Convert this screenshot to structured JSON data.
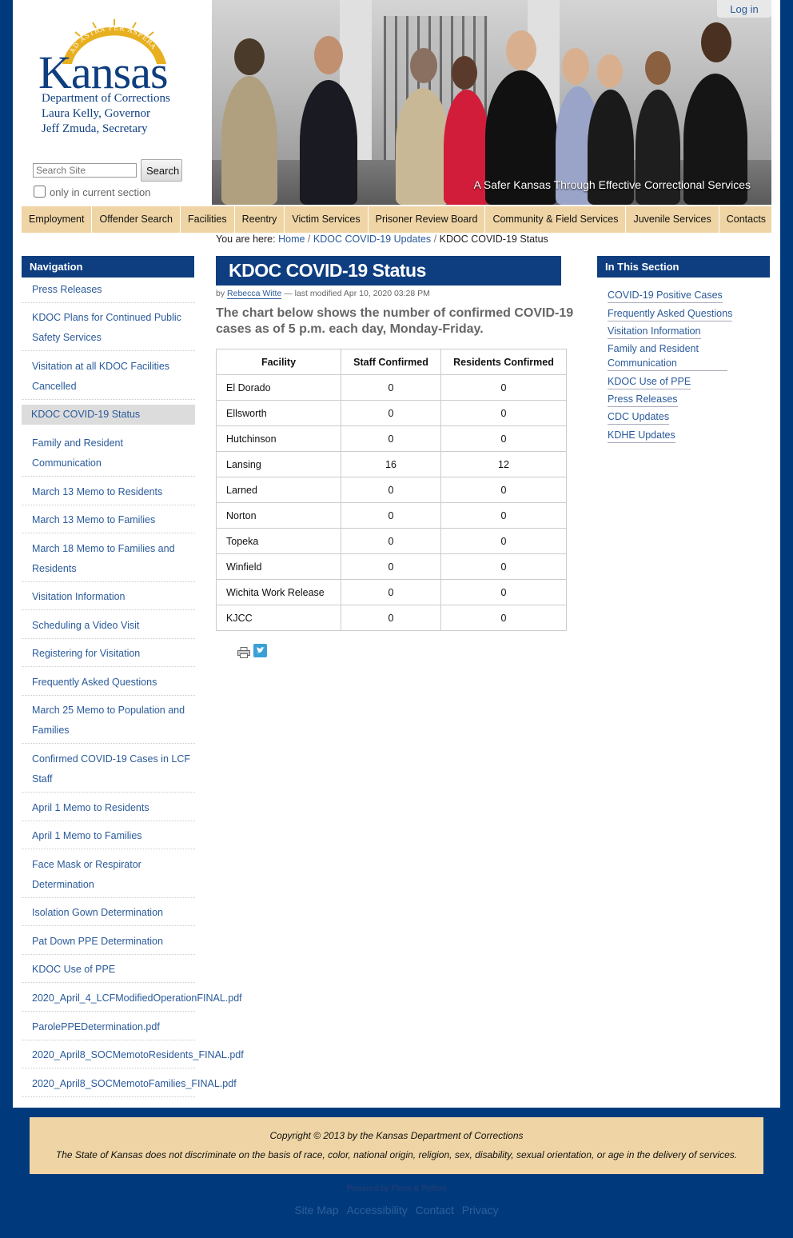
{
  "header": {
    "logo": {
      "motto": "AD ASTRA PER ASPERA",
      "word": "Kansas",
      "lines": [
        "Department of Corrections",
        "Laura Kelly, Governor",
        "Jeff Zmuda, Secretary"
      ]
    },
    "search": {
      "placeholder": "Search Site",
      "button_label": "Search",
      "checkbox_label": "only in current section"
    },
    "banner_tagline": "A Safer Kansas Through Effective Correctional Services",
    "login_label": "Log in"
  },
  "mainnav": [
    "Employment",
    "Offender Search",
    "Facilities",
    "Reentry",
    "Victim Services",
    "Prisoner Review Board",
    "Community & Field Services",
    "Juvenile Services",
    "Contacts"
  ],
  "breadcrumb": {
    "prefix": "You are here:",
    "items": [
      "Home",
      "KDOC COVID-19 Updates",
      "KDOC COVID-19 Status"
    ]
  },
  "leftnav": {
    "title": "Navigation",
    "items": [
      "Press Releases",
      "KDOC Plans for Continued Public Safety Services",
      "Visitation at all KDOC Facilities Cancelled",
      "KDOC COVID-19 Status",
      "Family and Resident Communication",
      "March 13 Memo to Residents",
      "March 13 Memo to Families",
      "March 18 Memo to Families and Residents",
      "Visitation Information",
      "Scheduling a Video Visit",
      "Registering for Visitation",
      "Frequently Asked Questions",
      "March 25 Memo to Population and Families",
      "Confirmed COVID-19 Cases in LCF Staff",
      "April 1 Memo to Residents",
      "April 1 Memo to Families",
      "Face Mask or Respirator Determination",
      "Isolation Gown Determination",
      "Pat Down PPE Determination",
      "KDOC Use of PPE",
      "2020_April_4_LCFModifiedOperationFINAL.pdf",
      "ParolePPEDetermination.pdf",
      "2020_April8_SOCMemotoResidents_FINAL.pdf",
      "2020_April8_SOCMemotoFamilies_FINAL.pdf"
    ],
    "current": "KDOC COVID-19 Status"
  },
  "content": {
    "title": "KDOC COVID-19 Status",
    "byline_prefix": "by",
    "author": "Rebecca Witte",
    "modified": "— last modified Apr 10, 2020 03:28 PM",
    "description": "The chart below shows the number of confirmed COVID-19 cases as of 5 p.m. each day, Monday-Friday.",
    "table": {
      "headers": [
        "Facility",
        "Staff Confirmed",
        "Residents Confirmed"
      ],
      "rows": [
        [
          "El Dorado",
          "0",
          "0"
        ],
        [
          "Ellsworth",
          "0",
          "0"
        ],
        [
          "Hutchinson",
          "0",
          "0"
        ],
        [
          "Lansing",
          "16",
          "12"
        ],
        [
          "Larned",
          "0",
          "0"
        ],
        [
          "Norton",
          "0",
          "0"
        ],
        [
          "Topeka",
          "0",
          "0"
        ],
        [
          "Winfield",
          "0",
          "0"
        ],
        [
          "Wichita Work Release",
          "0",
          "0"
        ],
        [
          "KJCC",
          "0",
          "0"
        ]
      ]
    }
  },
  "in_this_section": {
    "title": "In This Section",
    "items": [
      "COVID-19 Positive Cases",
      "Frequently Asked Questions",
      "Visitation Information",
      "Family and Resident Communication",
      "KDOC Use of PPE",
      "Press Releases",
      "CDC Updates",
      "KDHE Updates"
    ]
  },
  "footer": {
    "copyright": "Copyright © 2013 by the Kansas Department of Corrections",
    "legal": "The State of Kansas does not discriminate on the basis of race, color, national origin, religion, sex, disability, sexual orientation, or age in the delivery of services.",
    "powered": "Powered by Plone & Python",
    "links": [
      "Site Map",
      "Accessibility",
      "Contact",
      "Privacy"
    ]
  },
  "colors": {
    "brand_blue": "#0e3e80",
    "tan": "#efd5a5",
    "link": "#2a5a9a",
    "gold": "#e8b020"
  }
}
